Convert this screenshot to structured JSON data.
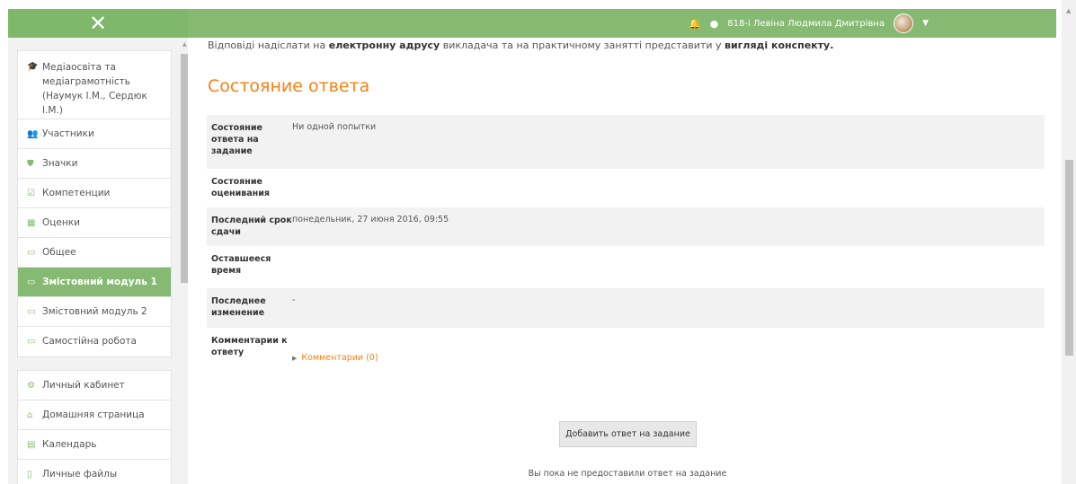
{
  "navbar": {
    "toggle_icon": "close-icon",
    "user_name": "818-i Левіна Людмила Дмитрівна",
    "bell_icon": "bell-icon",
    "chat_icon": "chat-icon",
    "caret_icon": "caret-down-icon",
    "bg_color": "#86ba72"
  },
  "sidebar": {
    "group1": [
      {
        "icon": "graduation-cap-icon",
        "label": "Медіаосвіта та медіаграмотність (Наумук І.М., Сердюк І.М.)"
      },
      {
        "icon": "users-icon",
        "label": "Участники"
      },
      {
        "icon": "shield-icon",
        "label": "Значки"
      },
      {
        "icon": "checkbox-icon",
        "label": "Компетенции"
      },
      {
        "icon": "table-icon",
        "label": "Оценки"
      },
      {
        "icon": "folder-icon",
        "label": "Общее"
      },
      {
        "icon": "folder-icon",
        "label": "Змістовний модуль 1",
        "active": true
      },
      {
        "icon": "folder-icon",
        "label": "Змістовний модуль 2"
      },
      {
        "icon": "folder-icon",
        "label": "Самостійна робота"
      }
    ],
    "group2": [
      {
        "icon": "dashboard-icon",
        "label": "Личный кабинет"
      },
      {
        "icon": "home-icon",
        "label": "Домашняя страница"
      },
      {
        "icon": "calendar-icon",
        "label": "Календарь"
      },
      {
        "icon": "file-icon",
        "label": "Личные файлы"
      }
    ]
  },
  "main": {
    "intro_pre": "Відповіді надіслати на ",
    "intro_b1": "електронну адрусу",
    "intro_mid": " викладача та на практичному занятті представити у ",
    "intro_b2": "вигляді конспекту.",
    "section_title": "Состояние ответа",
    "rows": [
      {
        "label": "Состояние ответа на задание",
        "value": "Ни одной попытки"
      },
      {
        "label": "Состояние оценивания",
        "value": ""
      },
      {
        "label": "Последний срок сдачи",
        "value": "понедельник, 27 июня 2016, 09:55"
      },
      {
        "label": "Оставшееся время",
        "value": ""
      },
      {
        "label": "Последнее изменение",
        "value": "-"
      },
      {
        "label": "Комментарии к ответу",
        "value": "Комментарии (0)"
      }
    ],
    "add_button": "Добавить ответ на задание",
    "note": "Вы пока не предоставили ответ на задание"
  },
  "colors": {
    "accent": "#f98012",
    "brand": "#86ba72"
  }
}
